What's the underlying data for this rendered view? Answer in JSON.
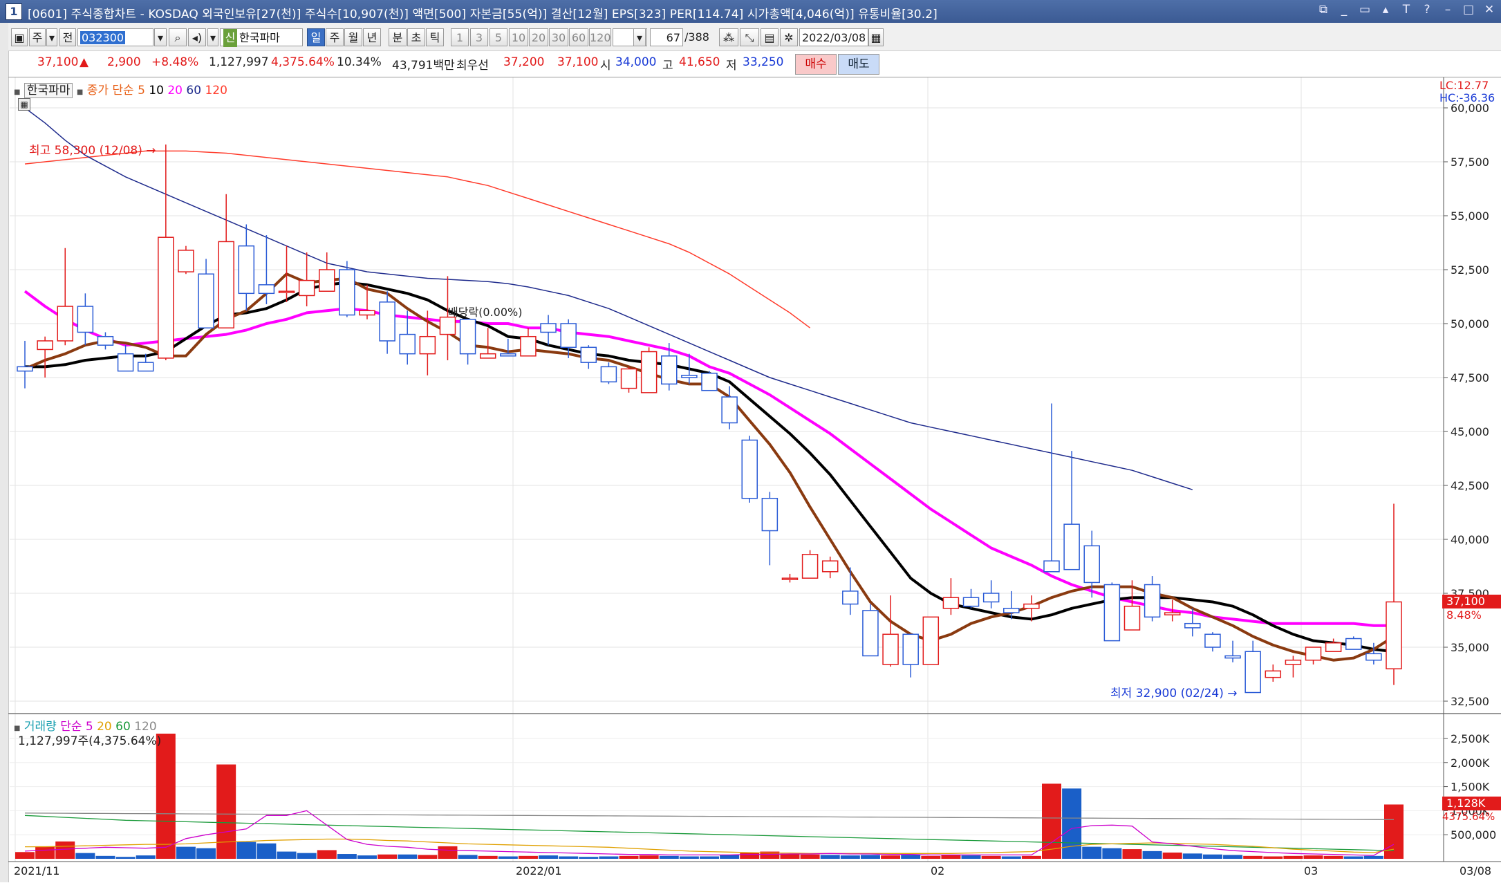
{
  "window": {
    "number": "1",
    "title": "[0601] 주식종합차트 - KOSDAQ 외국인보유[27(천)] 주식수[10,907(천)] 액면[500] 자본금[55(억)] 결산[12월] EPS[323] PER[114.74] 시가총액[4,046(억)] 유통비율[30.2]",
    "controls": [
      "⧉",
      "_",
      "▭",
      "▴",
      "T",
      "?",
      "–",
      "□",
      "✕"
    ]
  },
  "toolbar": {
    "mode_label": "주",
    "prev_label": "전",
    "stock_code": "032300",
    "sin_badge": "신",
    "stock_name": "한국파마",
    "periods": [
      "일",
      "주",
      "월",
      "년",
      "분",
      "초",
      "틱"
    ],
    "active_period": "일",
    "intervals": [
      "1",
      "3",
      "5",
      "10",
      "20",
      "30",
      "60",
      "120"
    ],
    "count_value": "67",
    "count_total": "/388",
    "date": "2022/03/08"
  },
  "quote": {
    "price": "37,100",
    "arrow": "▲",
    "change": "2,900",
    "change_pct": "+8.48%",
    "volume": "1,127,997",
    "volume_ratio": "4,375.64%",
    "turnover": "10.34%",
    "amount": "43,791백만",
    "best_label": "최우선",
    "best_ask": "37,200",
    "best_bid": "37,100",
    "open_label": "시",
    "open": "34,000",
    "high_label": "고",
    "high": "41,650",
    "low_label": "저",
    "low": "33,250",
    "buy_label": "매수",
    "sell_label": "매도"
  },
  "price_legend": {
    "name": "한국파마",
    "prefix": "종가 단순",
    "ma": [
      {
        "label": "5",
        "color": "#e8621a"
      },
      {
        "label": "10",
        "color": "#000000"
      },
      {
        "label": "20",
        "color": "#ff00ff"
      },
      {
        "label": "60",
        "color": "#1e2a8c"
      },
      {
        "label": "120",
        "color": "#ff3b2b"
      }
    ],
    "lc": "LC:12.77",
    "hc": "HC:-36.36"
  },
  "volume_legend": {
    "label": "거래량",
    "prefix": "단순",
    "ma": [
      {
        "label": "5",
        "color": "#cc00cc"
      },
      {
        "label": "20",
        "color": "#e0a000"
      },
      {
        "label": "60",
        "color": "#1a9a3a"
      },
      {
        "label": "120",
        "color": "#888888"
      }
    ],
    "sub": "1,127,997주(4,375.64%)"
  },
  "annotations": {
    "high_note": "최고 58,300 (12/08)",
    "low_note": "최저 32,900 (02/24)",
    "ex_note": "배당락(0.00%)",
    "price_tag": "37,100",
    "price_tag_pct": "8.48%",
    "vol_tag": "1,128K",
    "vol_tag_pct": "4375.64%"
  },
  "chart_data": {
    "type": "candlestick",
    "y_ticks": [
      "60,000",
      "57,500",
      "55,000",
      "52,500",
      "50,000",
      "47,500",
      "45,000",
      "42,500",
      "40,000",
      "37,500",
      "35,000",
      "32,500"
    ],
    "vol_ticks": [
      "2,500K",
      "2,000K",
      "1,500K",
      "1,000K",
      "500,000"
    ],
    "x_labels": [
      "2021/11",
      "2022/01",
      "02",
      "03",
      "03/08"
    ],
    "candles": [
      [
        48000,
        49200,
        47000,
        47800
      ],
      [
        48800,
        49400,
        47500,
        49200
      ],
      [
        49200,
        53500,
        49000,
        50800
      ],
      [
        50800,
        51400,
        49000,
        49600
      ],
      [
        49400,
        49600,
        48800,
        49000
      ],
      [
        48600,
        49000,
        48000,
        47800
      ],
      [
        48200,
        48600,
        47800,
        47800
      ],
      [
        48400,
        58300,
        48300,
        54000
      ],
      [
        52400,
        53600,
        52300,
        53400
      ],
      [
        52300,
        53000,
        49800,
        49800
      ],
      [
        49800,
        56000,
        49800,
        53800
      ],
      [
        53600,
        54600,
        50600,
        51400
      ],
      [
        51800,
        54100,
        50900,
        51400
      ],
      [
        51500,
        53600,
        51000,
        51500
      ],
      [
        51300,
        53300,
        50800,
        52000
      ],
      [
        51500,
        53300,
        51500,
        52500
      ],
      [
        52500,
        52900,
        50300,
        50400
      ],
      [
        50400,
        51800,
        50200,
        50600
      ],
      [
        51000,
        51500,
        48600,
        49200
      ],
      [
        49500,
        50600,
        48100,
        48600
      ],
      [
        48600,
        50600,
        47600,
        49400
      ],
      [
        49500,
        52200,
        48300,
        50300
      ],
      [
        50200,
        50200,
        48100,
        48600
      ],
      [
        48400,
        49800,
        48400,
        48600
      ],
      [
        48600,
        49300,
        48600,
        48500
      ],
      [
        48500,
        49800,
        48500,
        49400
      ],
      [
        50000,
        50400,
        49000,
        49600
      ],
      [
        50000,
        50200,
        48400,
        48900
      ],
      [
        48900,
        49000,
        47900,
        48200
      ],
      [
        48000,
        48200,
        47200,
        47300
      ],
      [
        47000,
        48000,
        46800,
        47900
      ],
      [
        46800,
        48900,
        46800,
        48700
      ],
      [
        48500,
        49100,
        46900,
        47200
      ],
      [
        47600,
        48600,
        47200,
        47500
      ],
      [
        47700,
        47800,
        46900,
        46900
      ],
      [
        46600,
        47100,
        45100,
        45400
      ],
      [
        44600,
        44800,
        41700,
        41900
      ],
      [
        41900,
        42200,
        38800,
        40400
      ],
      [
        38200,
        38400,
        38000,
        38200
      ],
      [
        38200,
        39500,
        38200,
        39300
      ],
      [
        38500,
        39200,
        38200,
        39000
      ],
      [
        37600,
        38700,
        36500,
        37000
      ],
      [
        36700,
        37000,
        34600,
        34600
      ],
      [
        34200,
        37400,
        34100,
        35600
      ],
      [
        35600,
        35600,
        33600,
        34200
      ],
      [
        34200,
        36300,
        34200,
        36400
      ],
      [
        36800,
        38200,
        36500,
        37300
      ],
      [
        37300,
        37700,
        36800,
        36900
      ],
      [
        37500,
        38100,
        36800,
        37100
      ],
      [
        36800,
        37600,
        36300,
        36600
      ],
      [
        36800,
        37400,
        36200,
        37000
      ],
      [
        39000,
        46300,
        38800,
        38500
      ],
      [
        40700,
        44100,
        38600,
        38600
      ],
      [
        39700,
        40400,
        37300,
        38000
      ],
      [
        37900,
        38000,
        35300,
        35300
      ],
      [
        35800,
        38100,
        35800,
        36900
      ],
      [
        37900,
        38300,
        36200,
        36400
      ],
      [
        36500,
        37200,
        36200,
        36600
      ],
      [
        36100,
        36800,
        35500,
        35900
      ],
      [
        35600,
        35700,
        34800,
        35000
      ],
      [
        34600,
        35300,
        34300,
        34500
      ],
      [
        34800,
        35300,
        32900,
        32900
      ],
      [
        33600,
        34200,
        33400,
        33900
      ],
      [
        34200,
        34600,
        33600,
        34400
      ],
      [
        34400,
        35000,
        34200,
        35000
      ],
      [
        34800,
        35400,
        35100,
        35200
      ],
      [
        35400,
        35500,
        34900,
        34900
      ],
      [
        34700,
        35200,
        34200,
        34400
      ],
      [
        34000,
        41650,
        33250,
        37100
      ]
    ],
    "volumes": [
      [
        140,
        "u"
      ],
      [
        260,
        "u"
      ],
      [
        360,
        "u"
      ],
      [
        120,
        "d"
      ],
      [
        60,
        "d"
      ],
      [
        40,
        "d"
      ],
      [
        70,
        "d"
      ],
      [
        2600,
        "u"
      ],
      [
        250,
        "d"
      ],
      [
        220,
        "d"
      ],
      [
        1960,
        "u"
      ],
      [
        350,
        "d"
      ],
      [
        320,
        "d"
      ],
      [
        150,
        "d"
      ],
      [
        120,
        "d"
      ],
      [
        180,
        "u"
      ],
      [
        100,
        "d"
      ],
      [
        70,
        "d"
      ],
      [
        90,
        "u"
      ],
      [
        90,
        "d"
      ],
      [
        80,
        "u"
      ],
      [
        260,
        "u"
      ],
      [
        80,
        "d"
      ],
      [
        60,
        "u"
      ],
      [
        50,
        "d"
      ],
      [
        60,
        "u"
      ],
      [
        70,
        "d"
      ],
      [
        50,
        "d"
      ],
      [
        40,
        "d"
      ],
      [
        50,
        "d"
      ],
      [
        60,
        "u"
      ],
      [
        70,
        "u"
      ],
      [
        60,
        "d"
      ],
      [
        50,
        "d"
      ],
      [
        50,
        "d"
      ],
      [
        80,
        "d"
      ],
      [
        120,
        "u"
      ],
      [
        150,
        "u"
      ],
      [
        110,
        "u"
      ],
      [
        90,
        "u"
      ],
      [
        80,
        "d"
      ],
      [
        70,
        "d"
      ],
      [
        80,
        "d"
      ],
      [
        70,
        "u"
      ],
      [
        80,
        "d"
      ],
      [
        60,
        "u"
      ],
      [
        80,
        "u"
      ],
      [
        70,
        "d"
      ],
      [
        60,
        "u"
      ],
      [
        50,
        "d"
      ],
      [
        60,
        "u"
      ],
      [
        1560,
        "u"
      ],
      [
        1460,
        "d"
      ],
      [
        250,
        "d"
      ],
      [
        220,
        "d"
      ],
      [
        200,
        "u"
      ],
      [
        160,
        "d"
      ],
      [
        130,
        "u"
      ],
      [
        110,
        "d"
      ],
      [
        90,
        "d"
      ],
      [
        80,
        "d"
      ],
      [
        60,
        "u"
      ],
      [
        50,
        "u"
      ],
      [
        60,
        "u"
      ],
      [
        70,
        "u"
      ],
      [
        60,
        "u"
      ],
      [
        50,
        "d"
      ],
      [
        60,
        "d"
      ],
      [
        1128,
        "u"
      ]
    ],
    "ma5": [
      47900,
      48300,
      48600,
      49000,
      49200,
      49100,
      48900,
      48500,
      48500,
      49500,
      50200,
      50600,
      51400,
      52300,
      51900,
      52000,
      52100,
      51600,
      51400,
      50700,
      50100,
      49600,
      49000,
      48900,
      48700,
      48800,
      48700,
      48600,
      48400,
      48300,
      48000,
      47700,
      47400,
      47200,
      47200,
      46600,
      45500,
      44400,
      43100,
      41500,
      40000,
      38500,
      37100,
      36200,
      35600,
      35300,
      35600,
      36100,
      36400,
      36600,
      36900,
      37300,
      37600,
      37800,
      37800,
      37800,
      37500,
      37300,
      36800,
      36400,
      36000,
      35500,
      35100,
      34800,
      34600,
      34400,
      34500,
      34900,
      35500
    ],
    "ma10": [
      48000,
      48000,
      48100,
      48300,
      48400,
      48500,
      48500,
      48700,
      49300,
      49900,
      50400,
      50500,
      50700,
      51100,
      51600,
      51800,
      51900,
      51800,
      51600,
      51400,
      51100,
      50600,
      50200,
      49900,
      49400,
      49300,
      49000,
      48800,
      48600,
      48500,
      48300,
      48200,
      48100,
      47900,
      47700,
      47300,
      46500,
      45700,
      44900,
      44000,
      43000,
      41800,
      40600,
      39400,
      38200,
      37500,
      37000,
      36800,
      36600,
      36400,
      36300,
      36500,
      36800,
      37000,
      37200,
      37300,
      37300,
      37300,
      37200,
      37100,
      36900,
      36500,
      36000,
      35600,
      35300,
      35200,
      35100,
      34900,
      34800
    ],
    "ma20": [
      51500,
      50800,
      50200,
      49700,
      49300,
      49000,
      49100,
      49200,
      49300,
      49400,
      49500,
      49700,
      50000,
      50200,
      50500,
      50600,
      50700,
      50600,
      50400,
      50300,
      50200,
      50100,
      50100,
      50000,
      50000,
      49800,
      49800,
      49600,
      49500,
      49400,
      49200,
      49000,
      48800,
      48500,
      48000,
      47700,
      47200,
      46700,
      46100,
      45500,
      44900,
      44200,
      43500,
      42800,
      42100,
      41400,
      40800,
      40200,
      39600,
      39200,
      38800,
      38300,
      37900,
      37600,
      37300,
      37100,
      36900,
      36700,
      36600,
      36400,
      36300,
      36200,
      36100,
      36100,
      36100,
      36100,
      36100,
      36000,
      36000
    ],
    "ma60": [
      60000,
      59300,
      58500,
      57800,
      57300,
      56800,
      56400,
      56000,
      55600,
      55200,
      54800,
      54400,
      54000,
      53600,
      53200,
      52800,
      52600,
      52400,
      52300,
      52200,
      52100,
      52050,
      52000,
      51950,
      51850,
      51700,
      51500,
      51300,
      51000,
      50700,
      50300,
      49900,
      49500,
      49100,
      48700,
      48300,
      47900,
      47500,
      47200,
      46900,
      46600,
      46300,
      46000,
      45700,
      45400,
      45200,
      45000,
      44800,
      44600,
      44400,
      44200,
      44000,
      43800,
      43600,
      43400,
      43200,
      42900,
      42600,
      42300
    ],
    "ma120": [
      57400,
      57500,
      57600,
      57700,
      57800,
      57900,
      58000,
      58000,
      58000,
      57950,
      57900,
      57800,
      57700,
      57600,
      57500,
      57400,
      57300,
      57200,
      57100,
      57000,
      56900,
      56800,
      56600,
      56400,
      56100,
      55800,
      55500,
      55200,
      54900,
      54600,
      54300,
      54000,
      53700,
      53300,
      52800,
      52300,
      51700,
      51100,
      50500,
      49800
    ],
    "vol_ma5": [
      160,
      180,
      200,
      220,
      240,
      230,
      220,
      240,
      420,
      500,
      560,
      620,
      900,
      900,
      1000,
      700,
      400,
      300,
      260,
      240,
      200,
      180,
      170,
      160,
      150,
      140,
      130,
      120,
      110,
      100,
      90,
      90,
      80,
      80,
      80,
      80,
      90,
      90,
      100,
      100,
      110,
      100,
      100,
      90,
      90,
      80,
      80,
      80,
      80,
      80,
      80,
      340,
      630,
      690,
      700,
      680,
      350,
      310,
      260,
      210,
      170,
      150,
      130,
      110,
      100,
      90,
      80,
      70,
      300
    ],
    "vol_ma20": [
      250,
      250,
      260,
      270,
      280,
      290,
      300,
      300,
      310,
      330,
      350,
      360,
      380,
      390,
      400,
      410,
      410,
      400,
      380,
      370,
      350,
      330,
      310,
      300,
      290,
      280,
      270,
      260,
      250,
      240,
      220,
      200,
      180,
      160,
      150,
      140,
      130,
      120,
      120,
      110,
      110,
      110,
      110,
      110,
      110,
      110,
      110,
      120,
      130,
      140,
      150,
      200,
      260,
      300,
      310,
      320,
      330,
      320,
      310,
      300,
      280,
      260,
      230,
      200,
      180,
      160,
      140,
      130,
      200
    ],
    "vol_ma60": [
      900,
      880,
      860,
      840,
      820,
      800,
      790,
      780,
      770,
      760,
      750,
      740,
      730,
      720,
      710,
      700,
      690,
      680,
      670,
      660,
      650,
      640,
      630,
      620,
      610,
      600,
      590,
      580,
      570,
      560,
      550,
      540,
      530,
      520,
      510,
      500,
      490,
      480,
      470,
      460,
      450,
      440,
      430,
      420,
      410,
      400,
      390,
      380,
      370,
      360,
      350,
      340,
      330,
      320,
      310,
      300,
      290,
      280,
      270,
      260,
      250,
      240,
      230,
      220,
      210,
      200,
      190,
      180,
      170
    ],
    "vol_ma120": [
      950,
      948,
      946,
      944,
      942,
      940,
      938,
      936,
      934,
      932,
      930,
      928,
      926,
      924,
      922,
      920,
      918,
      916,
      914,
      912,
      910,
      908,
      906,
      904,
      902,
      900,
      898,
      896,
      894,
      892,
      890,
      888,
      886,
      884,
      882,
      880,
      878,
      876,
      874,
      872,
      870,
      868,
      866,
      864,
      862,
      860,
      858,
      856,
      854,
      852,
      850,
      848,
      846,
      844,
      842,
      840,
      838,
      836,
      834,
      832,
      830,
      828,
      826,
      824,
      822,
      820,
      818,
      816,
      814
    ]
  }
}
